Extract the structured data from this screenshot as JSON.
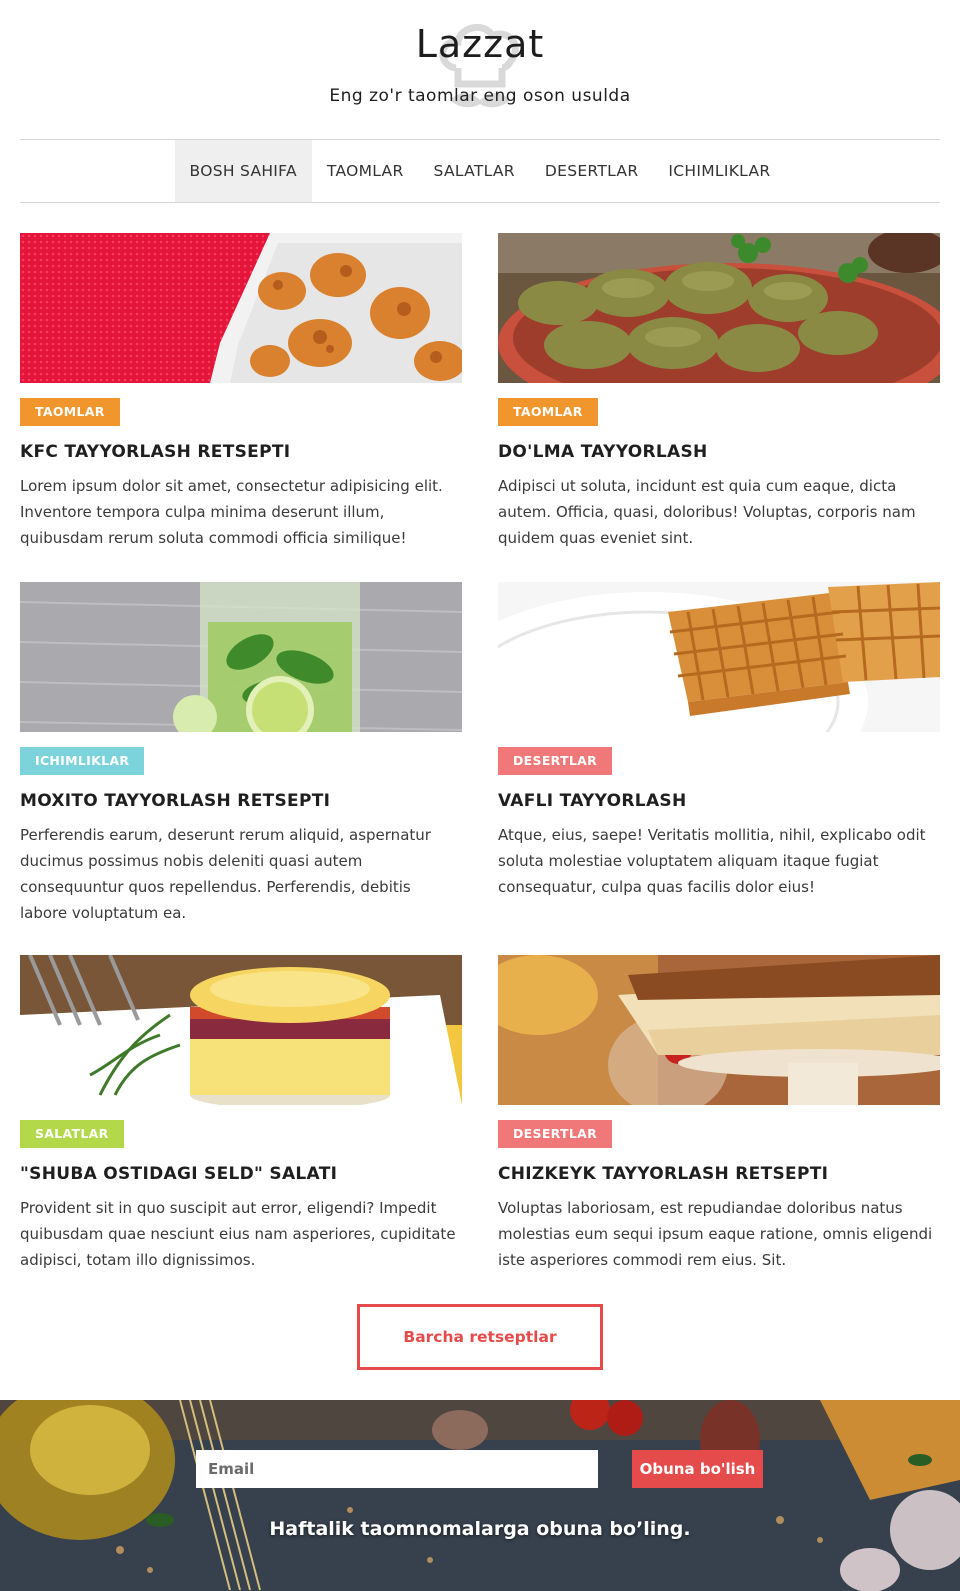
{
  "header": {
    "title": "Lazzat",
    "tagline": "Eng zo'r taomlar eng oson usulda"
  },
  "nav": {
    "items": [
      {
        "label": "BOSH SAHIFA"
      },
      {
        "label": "TAOMLAR"
      },
      {
        "label": "SALATLAR"
      },
      {
        "label": "DESERTLAR"
      },
      {
        "label": "ICHIMLIKLAR"
      }
    ],
    "active_index": 0
  },
  "colors": {
    "taomlar": "#f0962c",
    "ichimliklar": "#7dd3dc",
    "desertlar": "#f07878",
    "salatlar": "#b3d94a",
    "accent": "#e64b4b"
  },
  "cards": [
    {
      "category": "TAOMLAR",
      "title": "KFC TAYYORLASH RETSEPTI",
      "text": "Lorem ipsum dolor sit amet, consectetur adipisicing elit. Inventore tempora culpa minima deserunt illum, quibusdam rerum soluta commodi officia similique!",
      "image": "fried-chicken"
    },
    {
      "category": "TAOMLAR",
      "title": "DO'LMA TAYYORLASH",
      "text": "Adipisci ut soluta, incidunt est quia cum eaque, dicta autem. Officia, quasi, doloribus! Voluptas, corporis nam quidem quas eveniet sint.",
      "image": "dolma"
    },
    {
      "category": "ICHIMLIKLAR",
      "title": "MOXITO TAYYORLASH RETSEPTI",
      "text": "Perferendis earum, deserunt rerum aliquid, aspernatur ducimus possimus nobis deleniti quasi autem consequuntur quos repellendus. Perferendis, debitis labore voluptatum ea.",
      "image": "mojito"
    },
    {
      "category": "DESERTLAR",
      "title": "VAFLI TAYYORLASH",
      "text": "Atque, eius, saepe! Veritatis mollitia, nihil, explicabo odit soluta molestiae voluptatem aliquam itaque fugiat consequatur, culpa quas facilis dolor eius!",
      "image": "waffles"
    },
    {
      "category": "SALATLAR",
      "title": "\"SHUBA OSTIDAGI SELD\" SALATI",
      "text": "Provident sit in quo suscipit aut error, eligendi? Impedit quibusdam quae nesciunt eius nam asperiores, cupiditate adipisci, totam illo dignissimos.",
      "image": "layered-salad"
    },
    {
      "category": "DESERTLAR",
      "title": "CHIZKEYK TAYYORLASH RETSEPTI",
      "text": "Voluptas laboriosam, est repudiandae doloribus natus molestias eum sequi ipsum eaque ratione, omnis eligendi iste asperiores commodi rem eius. Sit.",
      "image": "cheesecake"
    }
  ],
  "cta": {
    "label": "Barcha retseptlar"
  },
  "footer": {
    "email_placeholder": "Email",
    "subscribe_label": "Obuna bo'lish",
    "text": "Haftalik taomnomalarga obuna bo’ling."
  }
}
